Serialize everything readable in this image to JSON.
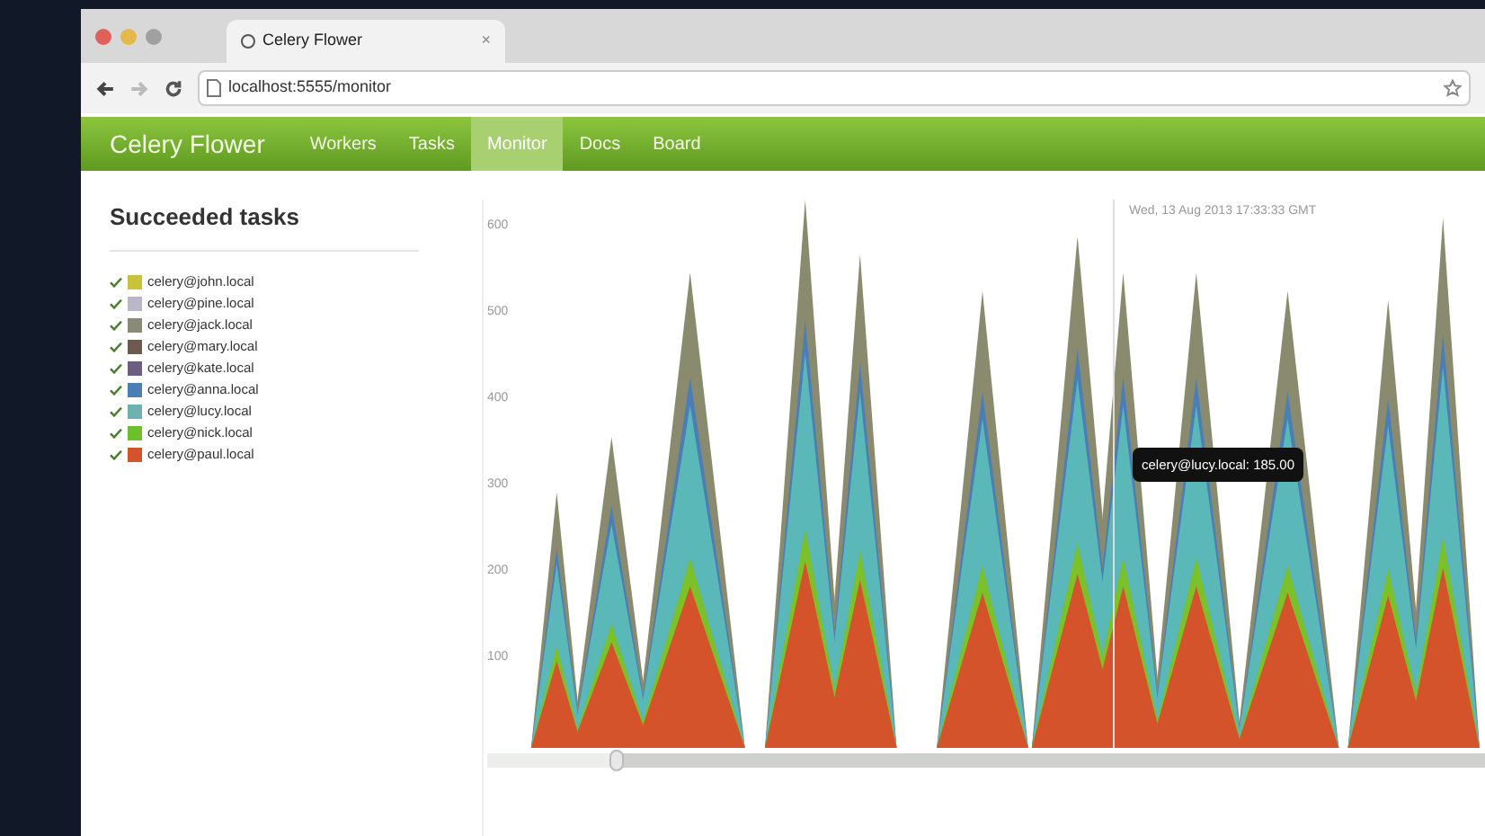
{
  "browser": {
    "tab_title": "Celery Flower",
    "tab_close": "×",
    "url": "localhost:5555/monitor"
  },
  "navbar": {
    "brand": "Celery Flower",
    "items": [
      {
        "label": "Workers",
        "selected": false
      },
      {
        "label": "Tasks",
        "selected": false
      },
      {
        "label": "Monitor",
        "selected": true
      },
      {
        "label": "Docs",
        "selected": false
      },
      {
        "label": "Board",
        "selected": false
      }
    ]
  },
  "legend": {
    "title": "Succeeded tasks",
    "items": [
      {
        "name": "celery@john.local",
        "checked": true,
        "color": "#c9c23a"
      },
      {
        "name": "celery@pine.local",
        "checked": true,
        "color": "#b8b8c8"
      },
      {
        "name": "celery@jack.local",
        "checked": true,
        "color": "#8a8a78"
      },
      {
        "name": "celery@mary.local",
        "checked": true,
        "color": "#6e5a4e"
      },
      {
        "name": "celery@kate.local",
        "checked": true,
        "color": "#6a5f80"
      },
      {
        "name": "celery@anna.local",
        "checked": true,
        "color": "#4a7fb5"
      },
      {
        "name": "celery@lucy.local",
        "checked": true,
        "color": "#6fb0b0"
      },
      {
        "name": "celery@nick.local",
        "checked": true,
        "color": "#6cc02a"
      },
      {
        "name": "celery@paul.local",
        "checked": true,
        "color": "#d5532a"
      }
    ]
  },
  "chart": {
    "y_ticks": [
      "600",
      "500",
      "400",
      "300",
      "200",
      "100"
    ],
    "hover_time": "Wed, 13 Aug 2013 17:33:33 GMT",
    "tooltip": "celery@lucy.local: 185.00"
  }
}
